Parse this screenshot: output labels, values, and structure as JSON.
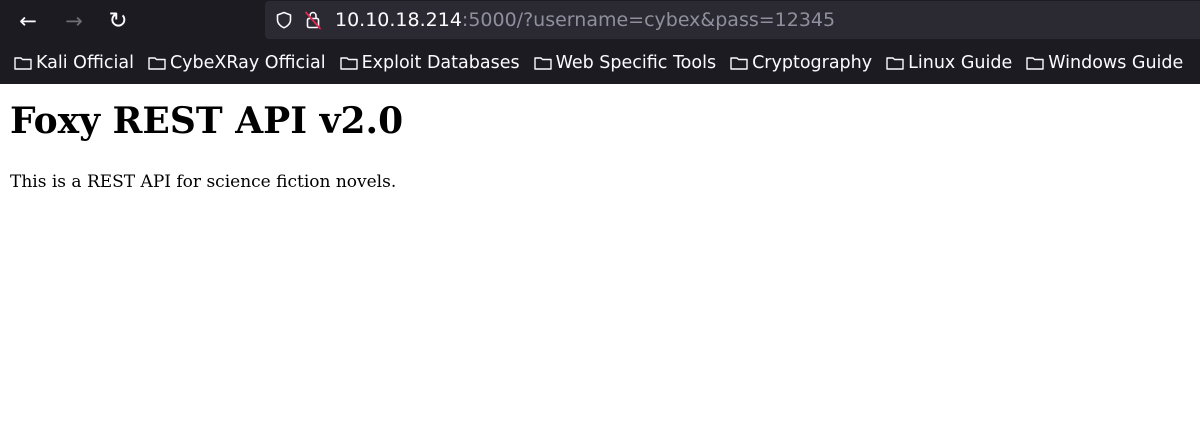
{
  "browser": {
    "nav": {
      "back_icon": "arrow-left-icon",
      "forward_icon": "arrow-right-icon",
      "reload_icon": "reload-icon"
    },
    "url": {
      "host": "10.10.18.214",
      "rest": ":5000/?username=cybex&pass=12345"
    },
    "bookmarks": [
      {
        "label": "Kali Official",
        "icon": "folder-icon"
      },
      {
        "label": "CybeXRay Official",
        "icon": "folder-icon"
      },
      {
        "label": "Exploit Databases",
        "icon": "folder-icon"
      },
      {
        "label": "Web Specific Tools",
        "icon": "folder-icon"
      },
      {
        "label": "Cryptography",
        "icon": "folder-icon"
      },
      {
        "label": "Linux Guide",
        "icon": "folder-icon"
      },
      {
        "label": "Windows Guide",
        "icon": "folder-icon"
      }
    ],
    "colors": {
      "toolbar_bg": "#1c1b22",
      "urlbar_bg": "#2b2a33",
      "text": "#fbfbfe",
      "url_dim": "#8f8f9d",
      "insecure_lock_slash": "#e22850"
    }
  },
  "page": {
    "title": "Foxy REST API v2.0",
    "description": "This is a REST API for science fiction novels."
  }
}
